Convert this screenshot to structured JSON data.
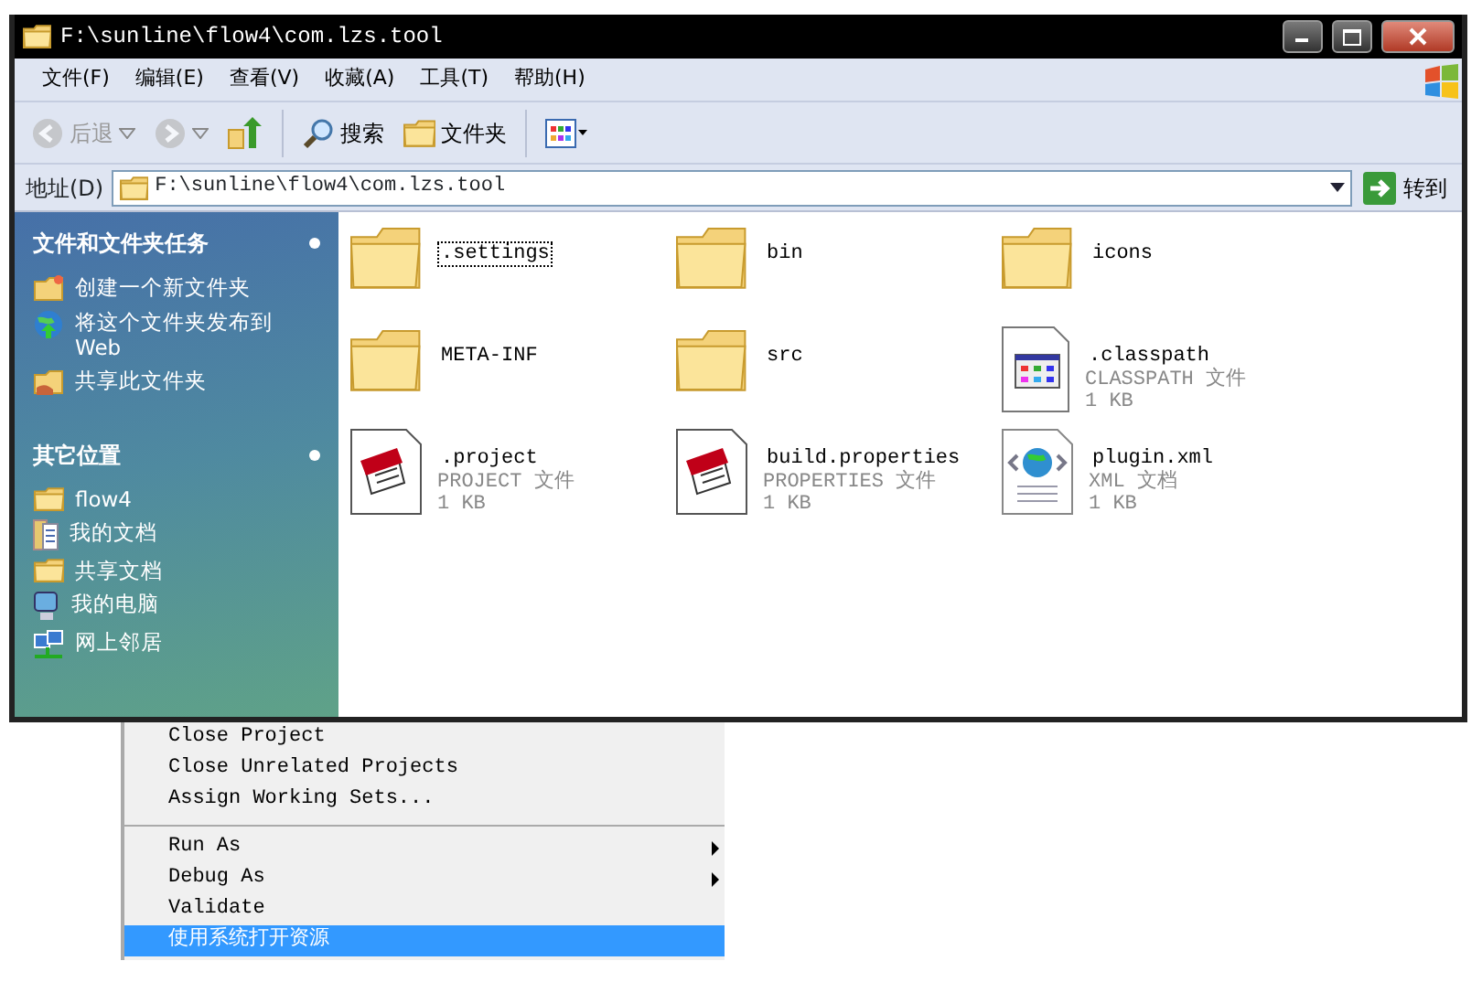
{
  "window": {
    "title": "F:\\sunline\\flow4\\com.lzs.tool"
  },
  "menu": [
    "文件(F)",
    "编辑(E)",
    "查看(V)",
    "收藏(A)",
    "工具(T)",
    "帮助(H)"
  ],
  "toolbar": [
    {
      "kind": "back",
      "label": "后退",
      "disabled": true
    },
    {
      "kind": "forward",
      "disabled": true
    },
    {
      "kind": "up",
      "disabled": false
    },
    {
      "kind": "search",
      "label": "搜索",
      "disabled": false
    },
    {
      "kind": "folders",
      "label": "文件夹",
      "disabled": false
    },
    {
      "kind": "views",
      "disabled": false
    }
  ],
  "address": {
    "label": "地址(D)",
    "value": "F:\\sunline\\flow4\\com.lzs.tool",
    "go": "转到"
  },
  "sidebar": [
    {
      "title": "文件和文件夹任务",
      "items": [
        {
          "kind": "new-folder",
          "label": "创建一个新文件夹"
        },
        {
          "kind": "publish",
          "label": "将这个文件夹发布到 Web"
        },
        {
          "kind": "share",
          "label": "共享此文件夹"
        }
      ]
    },
    {
      "title": "其它位置",
      "items": [
        {
          "kind": "folder",
          "label": "flow4"
        },
        {
          "kind": "documents",
          "label": "我的文档"
        },
        {
          "kind": "folder",
          "label": "共享文档"
        },
        {
          "kind": "computer",
          "label": "我的电脑"
        },
        {
          "kind": "network",
          "label": "网上邻居"
        }
      ]
    }
  ],
  "files": [
    {
      "kind": "folder",
      "name": ".settings",
      "focused": true
    },
    {
      "kind": "folder",
      "name": "bin",
      "focused": false
    },
    {
      "kind": "folder",
      "name": "icons",
      "focused": false
    },
    {
      "kind": "folder",
      "name": "META-INF",
      "focused": false
    },
    {
      "kind": "folder",
      "name": "src",
      "focused": false
    },
    {
      "kind": "window-file",
      "name": ".classpath",
      "type": "CLASSPATH 文件",
      "size": "1 KB",
      "focused": false
    },
    {
      "kind": "notepad-file",
      "name": ".project",
      "type": "PROJECT 文件",
      "size": "1 KB",
      "focused": false
    },
    {
      "kind": "notepad-file",
      "name": "build.properties",
      "type": "PROPERTIES 文件",
      "size": "1 KB",
      "focused": false
    },
    {
      "kind": "xml-file",
      "name": "plugin.xml",
      "type": "XML 文档",
      "size": "1 KB",
      "focused": false
    }
  ],
  "context_menu": [
    {
      "kind": "item",
      "label": "Close Project",
      "submenu": false,
      "selected": false
    },
    {
      "kind": "item",
      "label": "Close Unrelated Projects",
      "submenu": false,
      "selected": false
    },
    {
      "kind": "item",
      "label": "Assign Working Sets...",
      "submenu": false,
      "selected": false
    },
    {
      "kind": "separator"
    },
    {
      "kind": "item",
      "label": "Run As",
      "submenu": true,
      "selected": false
    },
    {
      "kind": "item",
      "label": "Debug As",
      "submenu": true,
      "selected": false
    },
    {
      "kind": "item",
      "label": "Validate",
      "submenu": false,
      "selected": false
    },
    {
      "kind": "item",
      "label": "使用系统打开资源",
      "submenu": false,
      "selected": true
    }
  ]
}
